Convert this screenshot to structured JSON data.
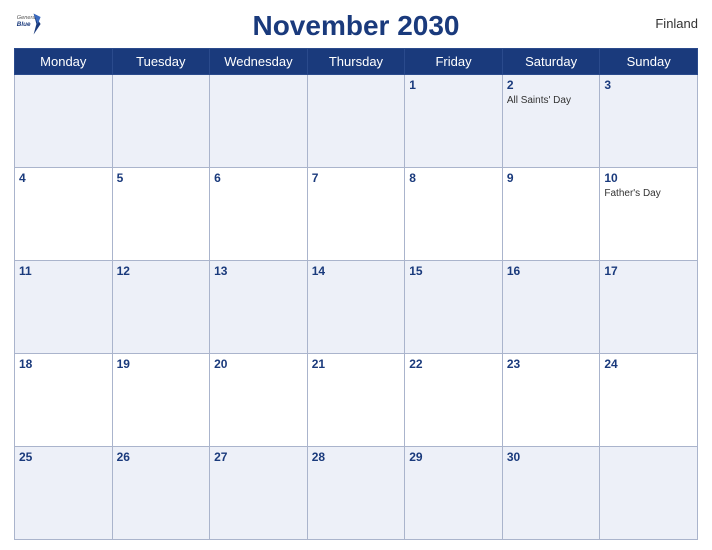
{
  "header": {
    "title": "November 2030",
    "country": "Finland",
    "logo_general": "General",
    "logo_blue": "Blue"
  },
  "weekdays": [
    "Monday",
    "Tuesday",
    "Wednesday",
    "Thursday",
    "Friday",
    "Saturday",
    "Sunday"
  ],
  "weeks": [
    [
      {
        "day": "",
        "events": []
      },
      {
        "day": "",
        "events": []
      },
      {
        "day": "",
        "events": []
      },
      {
        "day": "",
        "events": []
      },
      {
        "day": "1",
        "events": []
      },
      {
        "day": "2",
        "events": [
          "All Saints' Day"
        ]
      },
      {
        "day": "3",
        "events": []
      }
    ],
    [
      {
        "day": "4",
        "events": []
      },
      {
        "day": "5",
        "events": []
      },
      {
        "day": "6",
        "events": []
      },
      {
        "day": "7",
        "events": []
      },
      {
        "day": "8",
        "events": []
      },
      {
        "day": "9",
        "events": []
      },
      {
        "day": "10",
        "events": [
          "Father's Day"
        ]
      }
    ],
    [
      {
        "day": "11",
        "events": []
      },
      {
        "day": "12",
        "events": []
      },
      {
        "day": "13",
        "events": []
      },
      {
        "day": "14",
        "events": []
      },
      {
        "day": "15",
        "events": []
      },
      {
        "day": "16",
        "events": []
      },
      {
        "day": "17",
        "events": []
      }
    ],
    [
      {
        "day": "18",
        "events": []
      },
      {
        "day": "19",
        "events": []
      },
      {
        "day": "20",
        "events": []
      },
      {
        "day": "21",
        "events": []
      },
      {
        "day": "22",
        "events": []
      },
      {
        "day": "23",
        "events": []
      },
      {
        "day": "24",
        "events": []
      }
    ],
    [
      {
        "day": "25",
        "events": []
      },
      {
        "day": "26",
        "events": []
      },
      {
        "day": "27",
        "events": []
      },
      {
        "day": "28",
        "events": []
      },
      {
        "day": "29",
        "events": []
      },
      {
        "day": "30",
        "events": []
      },
      {
        "day": "",
        "events": []
      }
    ]
  ]
}
